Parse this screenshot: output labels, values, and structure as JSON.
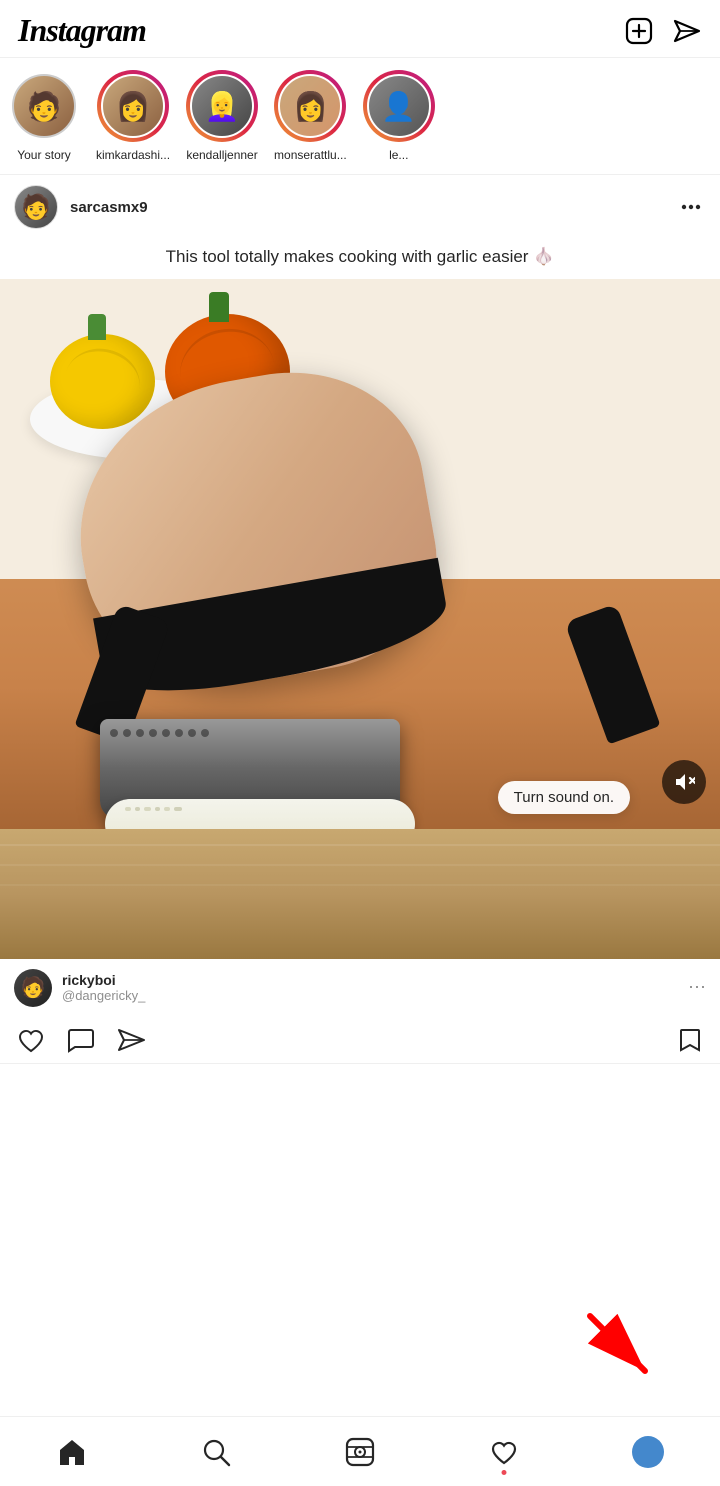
{
  "app": {
    "name": "Instagram",
    "logo": "Instagram"
  },
  "header": {
    "add_icon": "➕",
    "send_icon": "✈",
    "new_post_label": "New Post",
    "direct_label": "Direct Messages"
  },
  "stories": [
    {
      "id": "your-story",
      "label": "Your story",
      "ring": "your",
      "emoji": "🧑"
    },
    {
      "id": "kim",
      "label": "kimkardashi...",
      "ring": "gradient",
      "emoji": "👩"
    },
    {
      "id": "kendall",
      "label": "kendalljenner",
      "ring": "gradient",
      "emoji": "👱‍♀️"
    },
    {
      "id": "monse",
      "label": "monserattlu...",
      "ring": "gradient",
      "emoji": "👩"
    },
    {
      "id": "leo",
      "label": "le...",
      "ring": "gradient",
      "emoji": "👤"
    }
  ],
  "post": {
    "username": "sarcasmx9",
    "caption": "This tool totally makes cooking with garlic easier 🧄",
    "image_alt": "Garlic press tool video",
    "comment_user": "rickyboi",
    "comment_handle": "@dangericky_",
    "sound_tooltip": "Turn sound on.",
    "more_icon": "⋯"
  },
  "actions": {
    "like_label": "Like",
    "comment_label": "Comment",
    "share_label": "Share",
    "bookmark_label": "Bookmark"
  },
  "bottom_nav": {
    "home_label": "Home",
    "search_label": "Search",
    "reels_label": "Reels",
    "activity_label": "Activity",
    "profile_label": "Profile",
    "notification_dot": true
  },
  "arrow": {
    "visible": true,
    "color": "#ff0000"
  }
}
